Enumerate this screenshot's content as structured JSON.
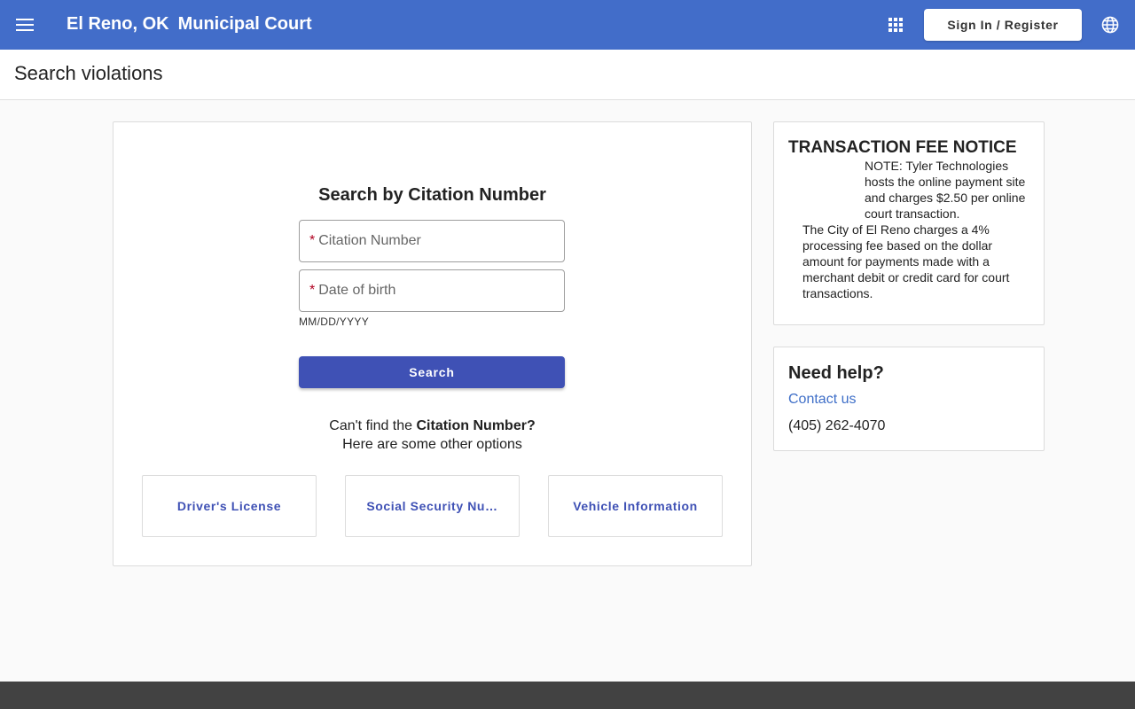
{
  "header": {
    "city": "El Reno, OK",
    "court": "Municipal Court",
    "signin_label": "Sign In / Register",
    "menu_icon": "hamburger-menu-icon",
    "apps_icon": "apps-grid-icon",
    "language_icon": "globe-icon",
    "background_color": "#426dc9"
  },
  "page": {
    "title": "Search violations"
  },
  "search": {
    "heading": "Search by Citation Number",
    "required_mark": "*",
    "citation_placeholder": "Citation Number",
    "dob_placeholder": "Date of birth",
    "dob_hint": "MM/DD/YYYY",
    "search_label": "Search",
    "cant_find_prefix": "Can't find the ",
    "cant_find_bold": "Citation Number?",
    "other_options": "Here are some other options",
    "button_color": "#3f51b5"
  },
  "options": [
    {
      "label": "Driver's License"
    },
    {
      "label": "Social Security Nu…"
    },
    {
      "label": "Vehicle Information"
    }
  ],
  "fee_notice": {
    "title": "TRANSACTION FEE NOTICE",
    "note": "NOTE: Tyler Technologies hosts the online payment site and charges $2.50 per online court transaction.",
    "body": "The City of El Reno charges a 4% processing fee based on the dollar amount for payments made with a merchant debit or credit card for court transactions."
  },
  "help": {
    "title": "Need help?",
    "contact_label": "Contact us",
    "phone": "(405) 262-4070"
  }
}
